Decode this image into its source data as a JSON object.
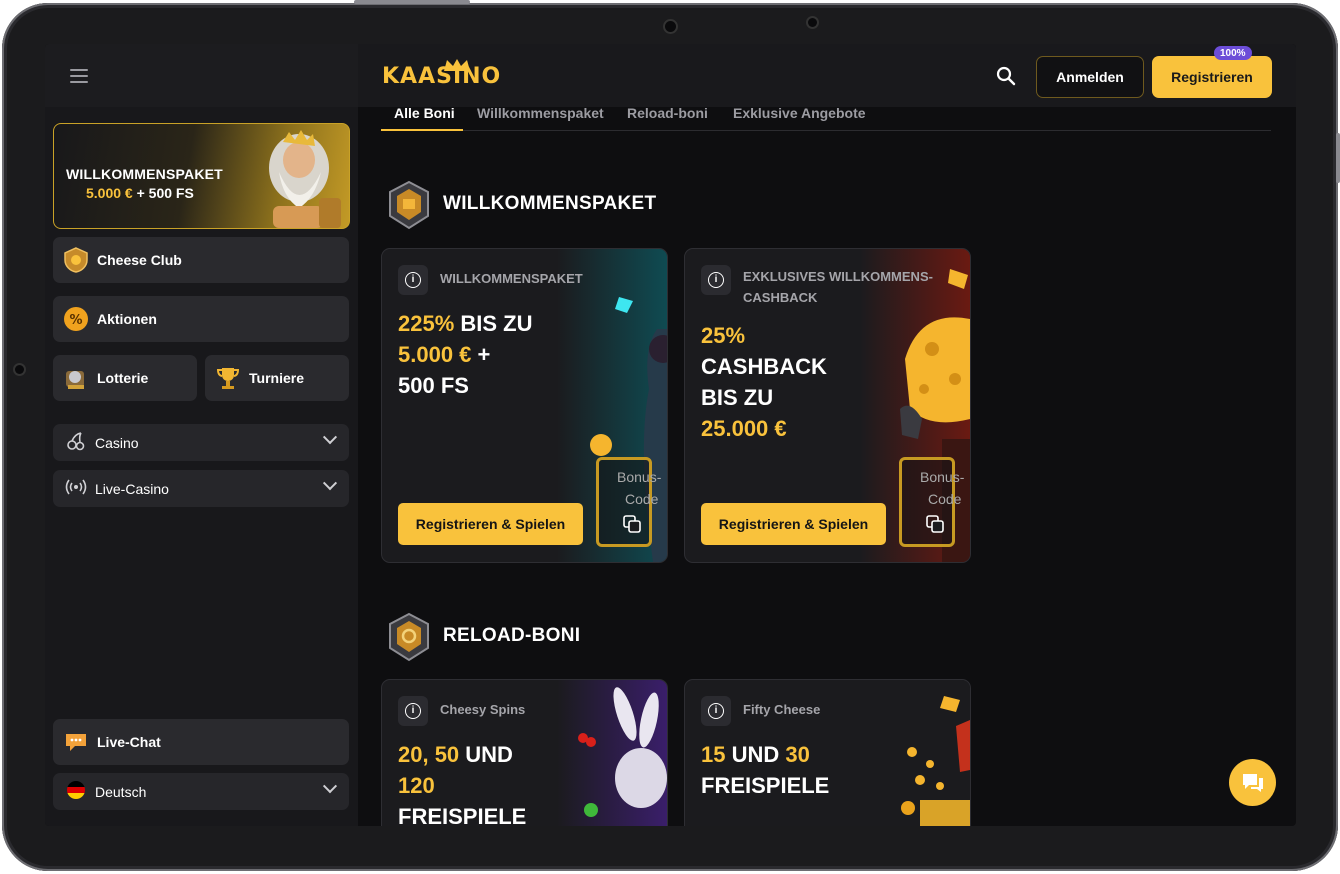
{
  "sidebar": {
    "promo": {
      "title": "WILLKOMMENSPAKET",
      "amount": "5.000 €",
      "plus": "+ 500 FS"
    },
    "buttons": {
      "cheese_club": "Cheese Club",
      "aktionen": "Aktionen",
      "lotterie": "Lotterie",
      "turniere": "Turniere"
    },
    "menu": {
      "casino": "Casino",
      "live_casino": "Live-Casino"
    },
    "live_chat": "Live-Chat",
    "language": "Deutsch"
  },
  "header": {
    "logo": "KAASINO",
    "login": "Anmelden",
    "register": "Registrieren",
    "badge": "100%"
  },
  "tabs": [
    "Alle Boni",
    "Willkommenspaket",
    "Reload-boni",
    "Exklusive Angebote"
  ],
  "sections": {
    "welcome": {
      "title": "WILLKOMMENSPAKET",
      "cards": [
        {
          "category": "WILLKOMMENSPAKET",
          "line1_y": "225%",
          "line1_w": " BIS ZU",
          "line2_y": "5.000 €",
          "line2_w": " +",
          "line3": "500 FS",
          "cta": "Registrieren & Spielen",
          "code_line1": "Bonus-",
          "code_line2": "Code"
        },
        {
          "category": "EXKLUSIVES WILLKOMMENS-CASHBACK",
          "line1": "25%",
          "line2": "CASHBACK",
          "line3": "BIS ZU",
          "line4": "25.000 €",
          "cta": "Registrieren & Spielen",
          "code_line1": "Bonus-",
          "code_line2": "Code"
        }
      ]
    },
    "reload": {
      "title": "RELOAD-BONI",
      "cards": [
        {
          "category": "Cheesy Spins",
          "line1_y": "20, 50",
          "line1_w": " UND",
          "line2": "120",
          "line3": "FREISPIELE"
        },
        {
          "category": "Fifty Cheese",
          "line1_y": "15",
          "line1_w": " UND ",
          "line1_y2": "30",
          "line2": "FREISPIELE"
        }
      ]
    }
  },
  "colors": {
    "accent": "#f9c23c",
    "background": "#0e0e10",
    "sidebar": "#18181b",
    "card": "#1b1b1e"
  },
  "icons": [
    "hamburger-icon",
    "search-icon",
    "cheese-club-icon",
    "percent-icon",
    "lottery-icon",
    "trophy-icon",
    "cherry-icon",
    "broadcast-icon",
    "chat-icon",
    "flag-de-icon",
    "info-icon",
    "copy-icon"
  ]
}
